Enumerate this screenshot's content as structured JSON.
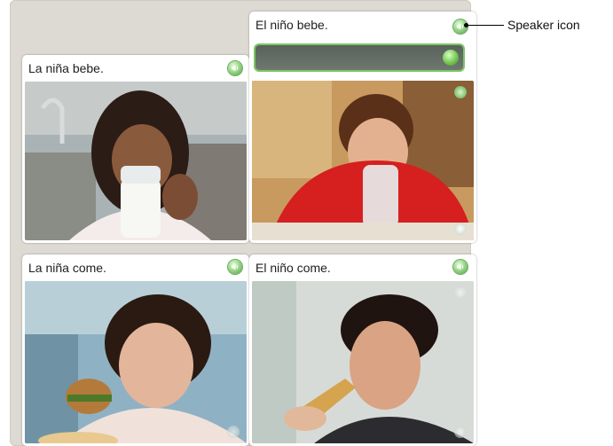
{
  "cards": [
    {
      "caption": "La niña bebe.",
      "image": "girl drinking milk"
    },
    {
      "caption": "El niño bebe.",
      "image": "boy drinking water"
    },
    {
      "caption": "La niña come.",
      "image": "girl eating hamburger"
    },
    {
      "caption": "El niño come.",
      "image": "boy eating sandwich"
    }
  ],
  "annotation": {
    "label": "Speaker icon"
  },
  "colors": {
    "speaker_green": "#6abf58",
    "answer_border": "#7ec563",
    "board": "#dcdad2"
  }
}
